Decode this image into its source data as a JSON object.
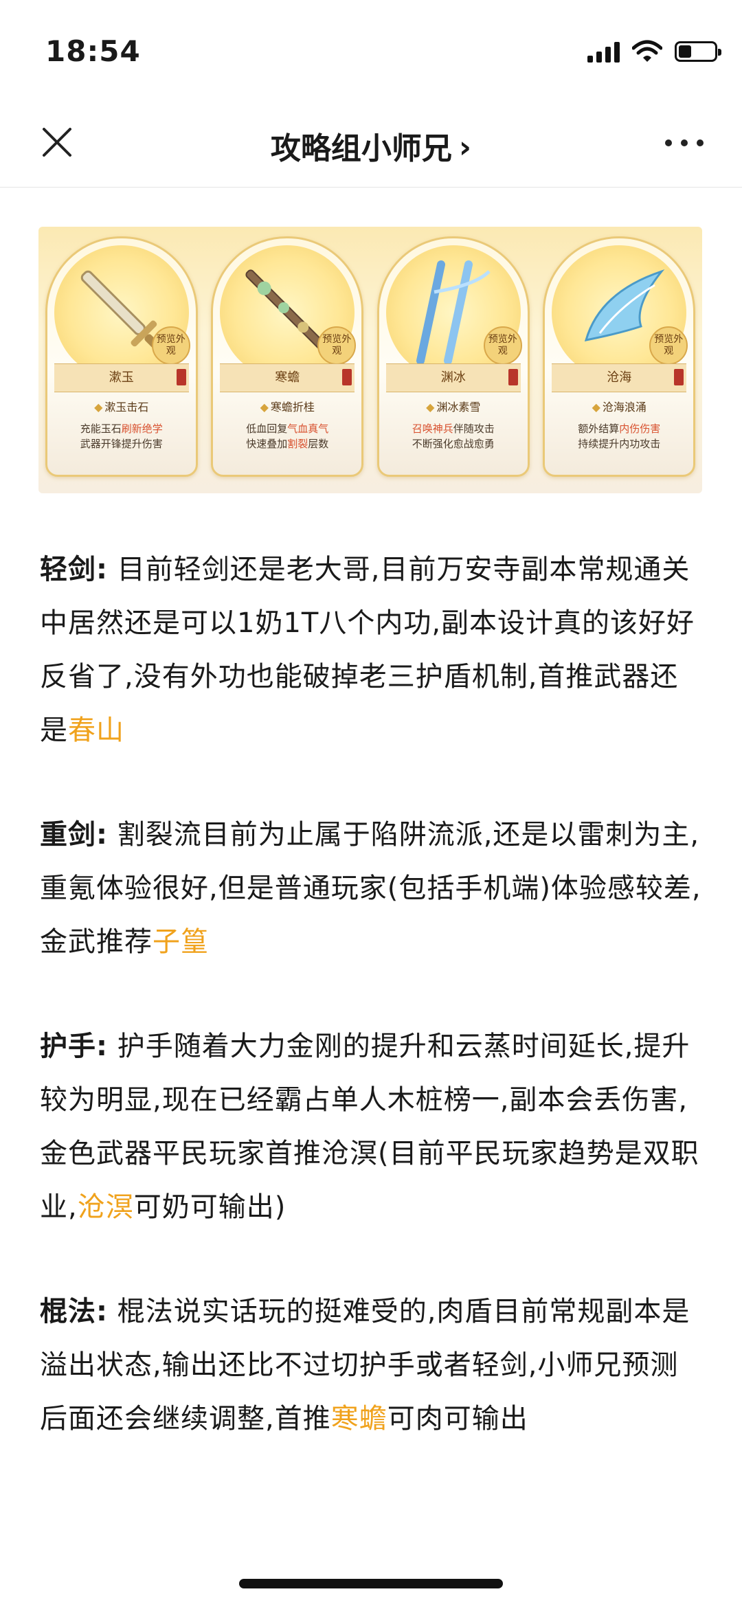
{
  "status_bar": {
    "time": "18:54",
    "battery_level": 0.35
  },
  "header": {
    "title": "攻略组小师兄",
    "chevron": "›",
    "close_icon": "close-icon",
    "more_icon": "more-dots-icon"
  },
  "banner": {
    "cards": [
      {
        "name": "漱玉",
        "badge": "预览外观",
        "skill": "漱玉击石",
        "desc_pre1": "充能玉石",
        "desc_hl1": "刷新绝学",
        "desc_post1": "",
        "desc_pre2": "武器开锋提升伤害",
        "desc_hl2": "",
        "desc_post2": ""
      },
      {
        "name": "寒蟾",
        "badge": "预览外观",
        "skill": "寒蟾折桂",
        "desc_pre1": "低血回复",
        "desc_hl1": "气血真气",
        "desc_post1": "",
        "desc_pre2": "快速叠加",
        "desc_hl2": "割裂",
        "desc_post2": "层数"
      },
      {
        "name": "渊冰",
        "badge": "预览外观",
        "skill": "渊冰素雪",
        "desc_pre1": "",
        "desc_hl1": "召唤神兵",
        "desc_post1": "伴随攻击",
        "desc_pre2": "不断强化愈战愈勇",
        "desc_hl2": "",
        "desc_post2": ""
      },
      {
        "name": "沧海",
        "badge": "预览外观",
        "skill": "沧海浪涌",
        "desc_pre1": "额外结算",
        "desc_hl1": "内伤伤害",
        "desc_post1": "",
        "desc_pre2": "持续提升内功攻击",
        "desc_hl2": "",
        "desc_post2": ""
      }
    ]
  },
  "article": {
    "paragraphs": [
      {
        "label": "轻剑:",
        "text": " 目前轻剑还是老大哥,目前万安寺副本常规通关中居然还是可以1奶1T八个内功,副本设计真的该好好反省了,没有外功也能破掉老三护盾机制,首推武器还是",
        "highlight": "春山",
        "tail": ""
      },
      {
        "label": "重剑:",
        "text": " 割裂流目前为止属于陷阱流派,还是以雷刺为主,重氪体验很好,但是普通玩家(包括手机端)体验感较差,金武推荐",
        "highlight": "子篁",
        "tail": ""
      },
      {
        "label": "护手:",
        "text": " 护手随着大力金刚的提升和云蒸时间延长,提升较为明显,现在已经霸占单人木桩榜一,副本会丢伤害,金色武器平民玩家首推沧溟(目前平民玩家趋势是双职业,",
        "highlight": "沧溟",
        "tail": "可奶可输出)"
      },
      {
        "label": "棍法:",
        "text": " 棍法说实话玩的挺难受的,肉盾目前常规副本是溢出状态,输出还比不过切护手或者轻剑,小师兄预测后面还会继续调整,首推",
        "highlight": "寒蟾",
        "tail": "可肉可输出"
      }
    ]
  },
  "colors": {
    "accent": "#f0a21c",
    "card_highlight": "#d8512f"
  }
}
